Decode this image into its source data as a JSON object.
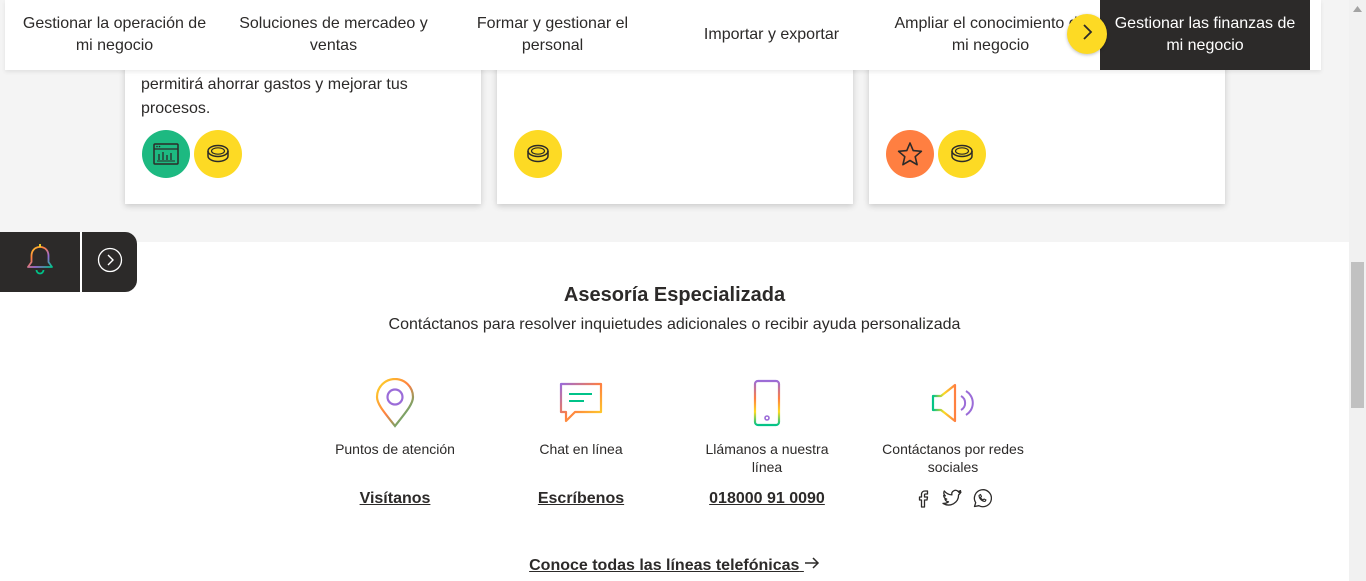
{
  "nav": {
    "tabs": [
      {
        "label": "Gestionar la operación de mi negocio"
      },
      {
        "label": "Soluciones de mercadeo y ventas"
      },
      {
        "label": "Formar y gestionar el personal"
      },
      {
        "label": "Importar y exportar"
      },
      {
        "label": "Ampliar el conocimiento de mi negocio"
      },
      {
        "label": "Gestionar las finanzas de mi negocio",
        "active": true
      }
    ],
    "next_icon": "chevron-right-icon"
  },
  "cards": [
    {
      "text": "permitirá ahorrar gastos y mejorar tus procesos.",
      "chips": [
        "dashboard-icon",
        "coin-icon"
      ]
    },
    {
      "text": "",
      "chips": [
        "coin-icon"
      ]
    },
    {
      "text": "",
      "chips": [
        "star-icon",
        "coin-icon"
      ]
    }
  ],
  "widget": {
    "bell_icon": "bell-icon",
    "arrow_icon": "chevron-right-circle-icon"
  },
  "asesoria": {
    "title": "Asesoría Especializada",
    "subtitle": "Contáctanos para resolver inquietudes adicionales o recibir ayuda personalizada",
    "items": [
      {
        "label": "Puntos de atención",
        "link": "Visítanos",
        "icon": "location-pin-icon"
      },
      {
        "label": "Chat en línea",
        "link": "Escríbenos",
        "icon": "chat-bubble-icon"
      },
      {
        "label": "Llámanos a nuestra línea",
        "link": "018000 91 0090",
        "icon": "phone-icon"
      },
      {
        "label": "Contáctanos por redes sociales",
        "icon": "megaphone-icon",
        "social": [
          "facebook-icon",
          "twitter-icon",
          "whatsapp-icon"
        ]
      }
    ],
    "all_lines": "Conoce todas las líneas telefónicas"
  },
  "colors": {
    "dark": "#2c2a29",
    "yellow": "#fdda24",
    "green": "#1db981",
    "orange": "#ff7f41",
    "grey_bg": "#f4f4f4"
  }
}
